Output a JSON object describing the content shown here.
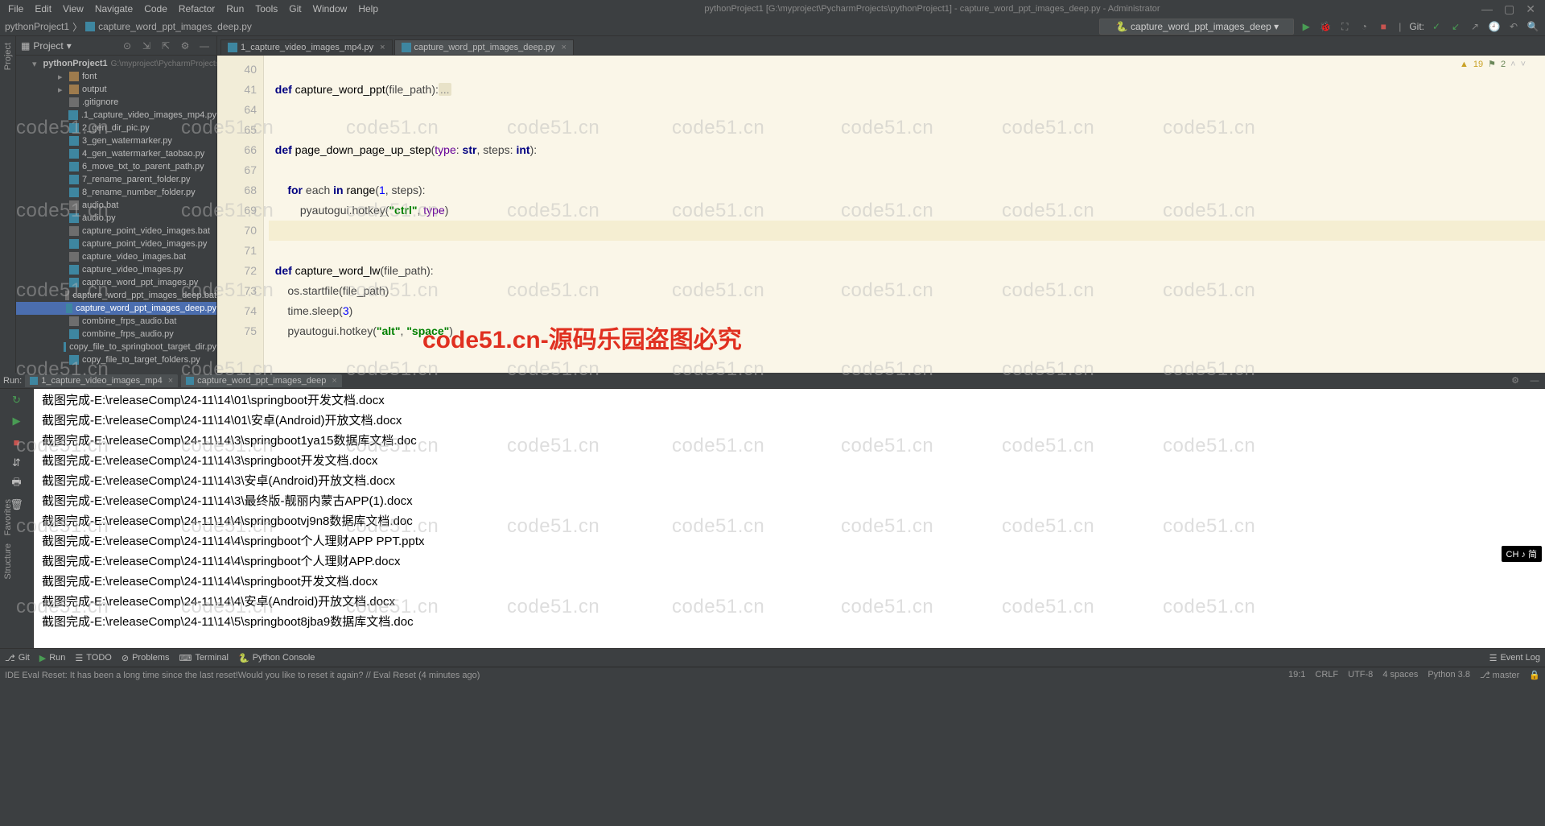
{
  "menu": [
    "File",
    "Edit",
    "View",
    "Navigate",
    "Code",
    "Refactor",
    "Run",
    "Tools",
    "Git",
    "Window",
    "Help"
  ],
  "title": "pythonProject1 [G:\\myproject\\PycharmProjects\\pythonProject1] - capture_word_ppt_images_deep.py - Administrator",
  "breadcrumb": {
    "project": "pythonProject1",
    "file": "capture_word_ppt_images_deep.py"
  },
  "runConfig": "capture_word_ppt_images_deep",
  "vcsLabel": "Git:",
  "projectPanel": {
    "title": "Project",
    "root": "pythonProject1",
    "rootHint": "G:\\myproject\\PycharmProjects",
    "items": [
      {
        "t": "folder",
        "n": "font",
        "ind": 3
      },
      {
        "t": "folder",
        "n": "output",
        "ind": 3
      },
      {
        "t": "txt",
        "n": ".gitignore",
        "ind": 3
      },
      {
        "t": "py",
        "n": ".1_capture_video_images_mp4.py",
        "ind": 3
      },
      {
        "t": "py",
        "n": "2_gen_dir_pic.py",
        "ind": 3
      },
      {
        "t": "py",
        "n": "3_gen_watermarker.py",
        "ind": 3
      },
      {
        "t": "py",
        "n": "4_gen_watermarker_taobao.py",
        "ind": 3
      },
      {
        "t": "py",
        "n": "6_move_txt_to_parent_path.py",
        "ind": 3
      },
      {
        "t": "py",
        "n": "7_rename_parent_folder.py",
        "ind": 3
      },
      {
        "t": "py",
        "n": "8_rename_number_folder.py",
        "ind": 3
      },
      {
        "t": "bat",
        "n": "audio.bat",
        "ind": 3
      },
      {
        "t": "py",
        "n": "audio.py",
        "ind": 3
      },
      {
        "t": "bat",
        "n": "capture_point_video_images.bat",
        "ind": 3
      },
      {
        "t": "py",
        "n": "capture_point_video_images.py",
        "ind": 3
      },
      {
        "t": "bat",
        "n": "capture_video_images.bat",
        "ind": 3
      },
      {
        "t": "py",
        "n": "capture_video_images.py",
        "ind": 3
      },
      {
        "t": "py",
        "n": "capture_word_ppt_images.py",
        "ind": 3
      },
      {
        "t": "bat",
        "n": "capture_word_ppt_images_deep.bat",
        "ind": 3
      },
      {
        "t": "py",
        "n": "capture_word_ppt_images_deep.py",
        "ind": 3,
        "sel": true
      },
      {
        "t": "bat",
        "n": "combine_frps_audio.bat",
        "ind": 3
      },
      {
        "t": "py",
        "n": "combine_frps_audio.py",
        "ind": 3
      },
      {
        "t": "py",
        "n": "copy_file_to_springboot_target_dir.py",
        "ind": 3
      },
      {
        "t": "py",
        "n": "copy_file_to_target_folders.py",
        "ind": 3
      }
    ]
  },
  "editorTabs": [
    {
      "name": "1_capture_video_images_mp4.py",
      "active": false
    },
    {
      "name": "capture_word_ppt_images_deep.py",
      "active": true
    }
  ],
  "gutter": [
    "40",
    "41",
    "64",
    "65",
    "66",
    "67",
    "68",
    "69",
    "70",
    "71",
    "72",
    "73",
    "74",
    "75"
  ],
  "warnings": {
    "yellow": "19",
    "green": "2"
  },
  "runHeader": "Run:",
  "runTabs": [
    {
      "name": "1_capture_video_images_mp4",
      "active": false
    },
    {
      "name": "capture_word_ppt_images_deep",
      "active": true
    }
  ],
  "console": [
    "截图完成-E:\\releaseComp\\24-11\\14\\01\\springboot开发文档.docx",
    "截图完成-E:\\releaseComp\\24-11\\14\\01\\安卓(Android)开放文档.docx",
    "截图完成-E:\\releaseComp\\24-11\\14\\3\\springboot1ya15数据库文档.doc",
    "截图完成-E:\\releaseComp\\24-11\\14\\3\\springboot开发文档.docx",
    "截图完成-E:\\releaseComp\\24-11\\14\\3\\安卓(Android)开放文档.docx",
    "截图完成-E:\\releaseComp\\24-11\\14\\3\\最终版-靓丽内蒙古APP(1).docx",
    "截图完成-E:\\releaseComp\\24-11\\14\\4\\springbootvj9n8数据库文档.doc",
    "截图完成-E:\\releaseComp\\24-11\\14\\4\\springboot个人理财APP PPT.pptx",
    "截图完成-E:\\releaseComp\\24-11\\14\\4\\springboot个人理财APP.docx",
    "截图完成-E:\\releaseComp\\24-11\\14\\4\\springboot开发文档.docx",
    "截图完成-E:\\releaseComp\\24-11\\14\\4\\安卓(Android)开放文档.docx",
    "截图完成-E:\\releaseComp\\24-11\\14\\5\\springboot8jba9数据库文档.doc"
  ],
  "bottomBar": {
    "git": "Git",
    "run": "Run",
    "todo": "TODO",
    "problems": "Problems",
    "terminal": "Terminal",
    "pyconsole": "Python Console",
    "eventlog": "Event Log"
  },
  "statusBar": {
    "msg": "IDE Eval Reset: It has been a long time since the last reset!Would you like to reset it again? // Eval Reset (4 minutes ago)",
    "pos": "19:1",
    "eol": "CRLF",
    "enc": "UTF-8",
    "indent": "4 spaces",
    "python": "Python 3.8",
    "branch": "master",
    "lock": "🔒"
  },
  "leftStrip": [
    "Project"
  ],
  "leftStripBottom": [
    "Favorites",
    "Structure"
  ],
  "ime": "CH ♪ 简",
  "watermark": "code51.cn",
  "watermarkRed": "code51.cn-源码乐园盗图必究"
}
